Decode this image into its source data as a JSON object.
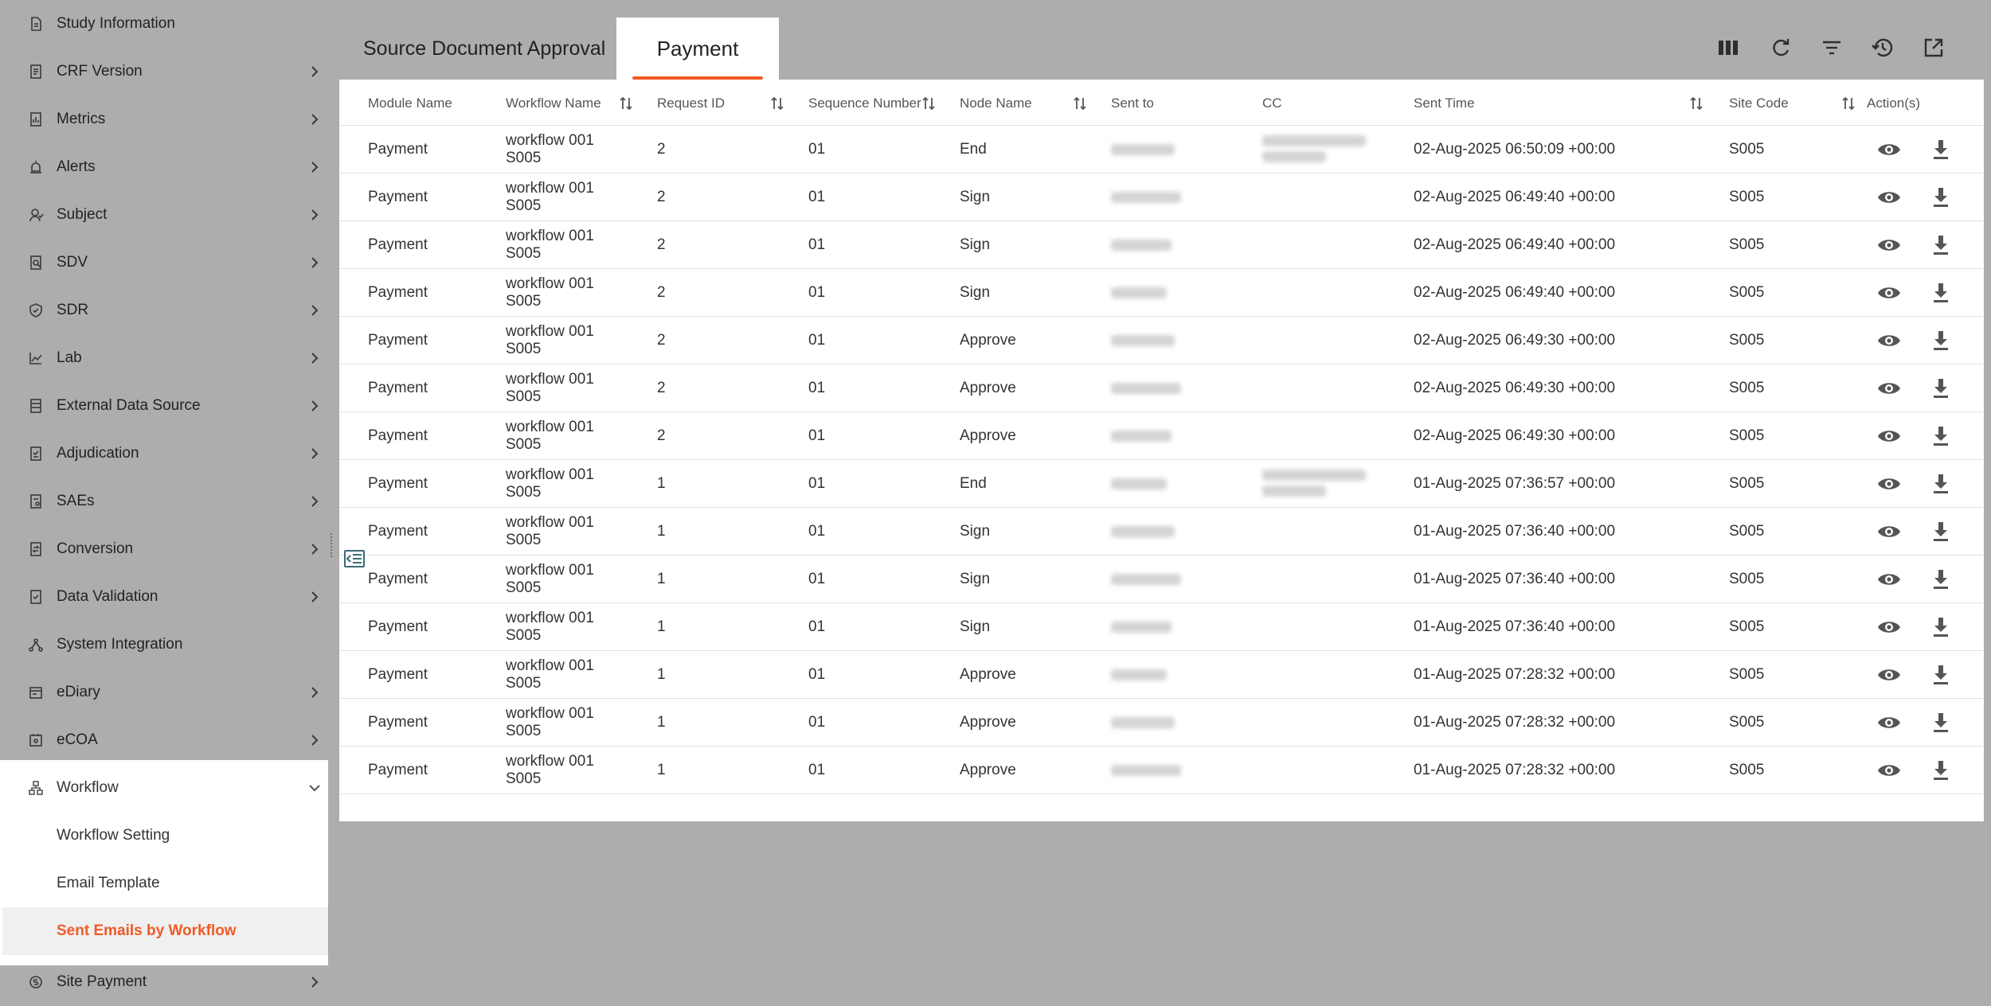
{
  "sidebar": {
    "items": [
      {
        "label": "Study Information",
        "icon": "document-icon",
        "chevron": false
      },
      {
        "label": "CRF Version",
        "icon": "form-icon",
        "chevron": true
      },
      {
        "label": "Metrics",
        "icon": "metrics-icon",
        "chevron": true
      },
      {
        "label": "Alerts",
        "icon": "alarm-icon",
        "chevron": true
      },
      {
        "label": "Subject",
        "icon": "subject-icon",
        "chevron": true
      },
      {
        "label": "SDV",
        "icon": "sdv-icon",
        "chevron": true
      },
      {
        "label": "SDR",
        "icon": "shield-icon",
        "chevron": true
      },
      {
        "label": "Lab",
        "icon": "chart-line-icon",
        "chevron": true
      },
      {
        "label": "External Data Source",
        "icon": "database-icon",
        "chevron": true
      },
      {
        "label": "Adjudication",
        "icon": "adjudication-icon",
        "chevron": true
      },
      {
        "label": "SAEs",
        "icon": "sae-icon",
        "chevron": true
      },
      {
        "label": "Conversion",
        "icon": "conversion-icon",
        "chevron": true
      },
      {
        "label": "Data Validation",
        "icon": "validation-icon",
        "chevron": true
      },
      {
        "label": "System Integration",
        "icon": "integration-icon",
        "chevron": false
      },
      {
        "label": "eDiary",
        "icon": "ediary-icon",
        "chevron": true
      },
      {
        "label": "eCOA",
        "icon": "ecoa-icon",
        "chevron": true
      },
      {
        "label": "Workflow",
        "icon": "workflow-icon",
        "chevron": true,
        "expanded": true
      }
    ],
    "workflow_sub": [
      {
        "label": "Workflow Setting",
        "active": false
      },
      {
        "label": "Email Template",
        "active": false
      },
      {
        "label": "Sent Emails by Workflow",
        "active": true
      }
    ],
    "bottom_item": {
      "label": "Site Payment",
      "icon": "payment-icon"
    }
  },
  "tabs": [
    {
      "label": "Source Document Approval",
      "active": false
    },
    {
      "label": "Payment",
      "active": true
    }
  ],
  "toolbar_icons": [
    "columns-icon",
    "refresh-icon",
    "filter-icon",
    "history-icon",
    "export-icon"
  ],
  "table": {
    "headers": [
      "Module Name",
      "Workflow Name",
      "Request ID",
      "Sequence Number",
      "Node Name",
      "Sent to",
      "CC",
      "Sent Time",
      "Site Code",
      "Action(s)"
    ],
    "rows": [
      [
        "Payment",
        "workflow 001",
        "S005",
        "2",
        "01",
        "End",
        "02-Aug-2025 06:50:09 +00:00",
        "S005"
      ],
      [
        "Payment",
        "workflow 001",
        "S005",
        "2",
        "01",
        "Sign",
        "02-Aug-2025 06:49:40 +00:00",
        "S005"
      ],
      [
        "Payment",
        "workflow 001",
        "S005",
        "2",
        "01",
        "Sign",
        "02-Aug-2025 06:49:40 +00:00",
        "S005"
      ],
      [
        "Payment",
        "workflow 001",
        "S005",
        "2",
        "01",
        "Sign",
        "02-Aug-2025 06:49:40 +00:00",
        "S005"
      ],
      [
        "Payment",
        "workflow 001",
        "S005",
        "2",
        "01",
        "Approve",
        "02-Aug-2025 06:49:30 +00:00",
        "S005"
      ],
      [
        "Payment",
        "workflow 001",
        "S005",
        "2",
        "01",
        "Approve",
        "02-Aug-2025 06:49:30 +00:00",
        "S005"
      ],
      [
        "Payment",
        "workflow 001",
        "S005",
        "2",
        "01",
        "Approve",
        "02-Aug-2025 06:49:30 +00:00",
        "S005"
      ],
      [
        "Payment",
        "workflow 001",
        "S005",
        "1",
        "01",
        "End",
        "01-Aug-2025 07:36:57 +00:00",
        "S005"
      ],
      [
        "Payment",
        "workflow 001",
        "S005",
        "1",
        "01",
        "Sign",
        "01-Aug-2025 07:36:40 +00:00",
        "S005"
      ],
      [
        "Payment",
        "workflow 001",
        "S005",
        "1",
        "01",
        "Sign",
        "01-Aug-2025 07:36:40 +00:00",
        "S005"
      ],
      [
        "Payment",
        "workflow 001",
        "S005",
        "1",
        "01",
        "Sign",
        "01-Aug-2025 07:36:40 +00:00",
        "S005"
      ],
      [
        "Payment",
        "workflow 001",
        "S005",
        "1",
        "01",
        "Approve",
        "01-Aug-2025 07:28:32 +00:00",
        "S005"
      ],
      [
        "Payment",
        "workflow 001",
        "S005",
        "1",
        "01",
        "Approve",
        "01-Aug-2025 07:28:32 +00:00",
        "S005"
      ],
      [
        "Payment",
        "workflow 001",
        "S005",
        "1",
        "01",
        "Approve",
        "01-Aug-2025 07:28:32 +00:00",
        "S005"
      ]
    ],
    "cc_blurred_rows": [
      0,
      7
    ]
  },
  "colors": {
    "accent": "#f15a24",
    "overlay": "rgba(0,0,0,0.32)"
  }
}
